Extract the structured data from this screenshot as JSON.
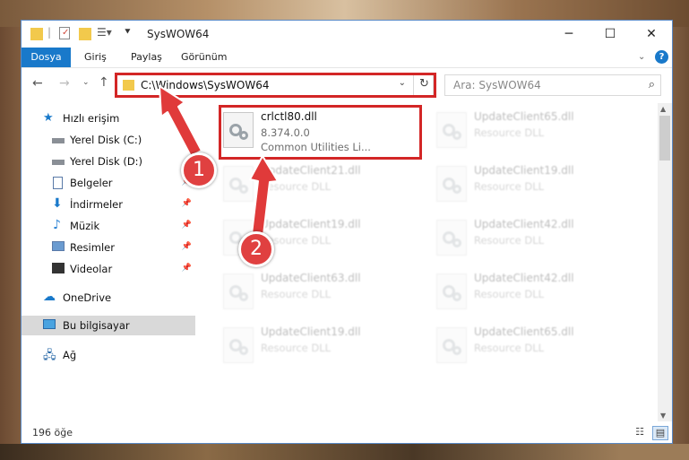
{
  "window": {
    "title": "SysWOW64"
  },
  "ribbon": {
    "tabs": [
      "Dosya",
      "Giriş",
      "Paylaş",
      "Görünüm"
    ]
  },
  "nav": {
    "address": "C:\\Windows\\SysWOW64",
    "search_placeholder": "Ara: SysWOW64"
  },
  "sidebar": {
    "items": [
      {
        "label": "Hızlı erişim",
        "icon": "star-icon"
      },
      {
        "label": "Yerel Disk (C:)",
        "icon": "drive-icon"
      },
      {
        "label": "Yerel Disk (D:)",
        "icon": "drive-icon"
      },
      {
        "label": "Belgeler",
        "icon": "documents-icon"
      },
      {
        "label": "İndirmeler",
        "icon": "download-icon"
      },
      {
        "label": "Müzik",
        "icon": "music-icon"
      },
      {
        "label": "Resimler",
        "icon": "pictures-icon"
      },
      {
        "label": "Videolar",
        "icon": "videos-icon"
      },
      {
        "label": "OneDrive",
        "icon": "cloud-icon"
      },
      {
        "label": "Bu bilgisayar",
        "icon": "computer-icon"
      },
      {
        "label": "Ağ",
        "icon": "network-icon"
      }
    ]
  },
  "files": [
    {
      "name": "crlctl80.dll",
      "line2": "8.374.0.0",
      "line3": "Common Utilities Li..."
    },
    {
      "name": "UpdateClient65.dll",
      "line2": "Resource DLL"
    },
    {
      "name": "UpdateClient21.dll",
      "line2": "Resource DLL"
    },
    {
      "name": "UpdateClient19.dll",
      "line2": "Resource DLL"
    },
    {
      "name": "UpdateClient19.dll",
      "line2": "Resource DLL"
    },
    {
      "name": "UpdateClient42.dll",
      "line2": "Resource DLL"
    },
    {
      "name": "UpdateClient63.dll",
      "line2": "Resource DLL"
    },
    {
      "name": "UpdateClient42.dll",
      "line2": "Resource DLL"
    },
    {
      "name": "UpdateClient19.dll",
      "line2": "Resource DLL"
    },
    {
      "name": "UpdateClient65.dll",
      "line2": "Resource DLL"
    }
  ],
  "status": {
    "count": "196 öğe"
  },
  "annotations": {
    "badge1": "1",
    "badge2": "2"
  },
  "colors": {
    "highlight": "#d32626",
    "file_tab": "#1979ca",
    "badge": "#e04040"
  }
}
